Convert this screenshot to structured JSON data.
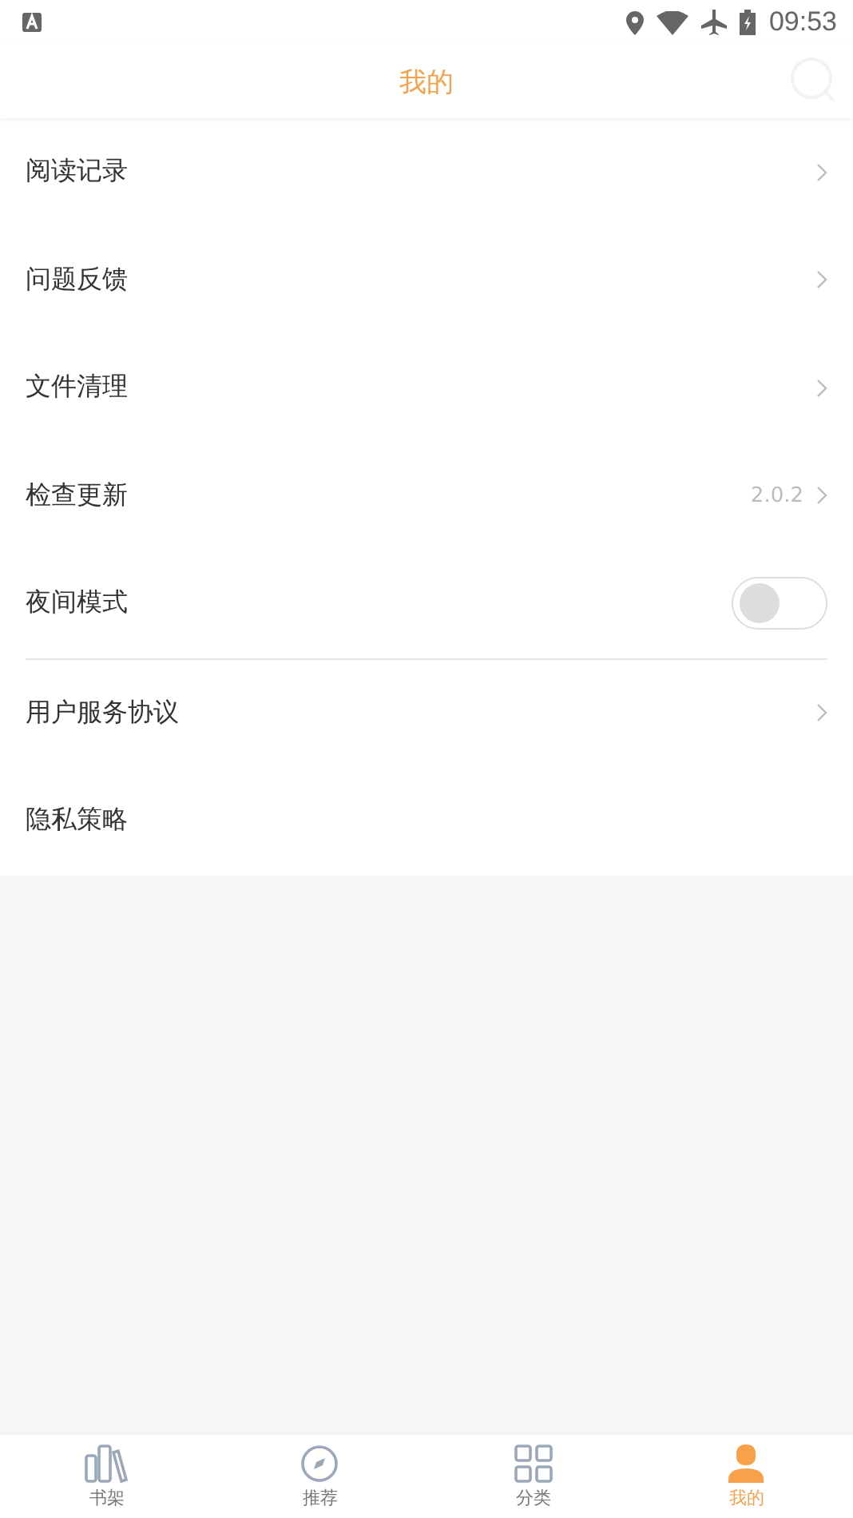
{
  "status_bar": {
    "time": "09:53"
  },
  "header": {
    "title": "我的"
  },
  "menu_groups": [
    {
      "items": [
        {
          "label": "阅读记录",
          "kind": "link"
        },
        {
          "label": "问题反馈",
          "kind": "link"
        },
        {
          "label": "文件清理",
          "kind": "link"
        },
        {
          "label": "检查更新",
          "kind": "value",
          "value": "2.0.2"
        },
        {
          "label": "夜间模式",
          "kind": "toggle",
          "on": false
        }
      ]
    },
    {
      "items": [
        {
          "label": "用户服务协议",
          "kind": "link"
        },
        {
          "label": "隐私策略",
          "kind": "plain"
        }
      ]
    }
  ],
  "tab_bar": [
    {
      "label": "书架",
      "kind": "books",
      "selected": false
    },
    {
      "label": "推荐",
      "kind": "compass",
      "selected": false
    },
    {
      "label": "分类",
      "kind": "grid",
      "selected": false
    },
    {
      "label": "我的",
      "kind": "person",
      "selected": true
    }
  ]
}
